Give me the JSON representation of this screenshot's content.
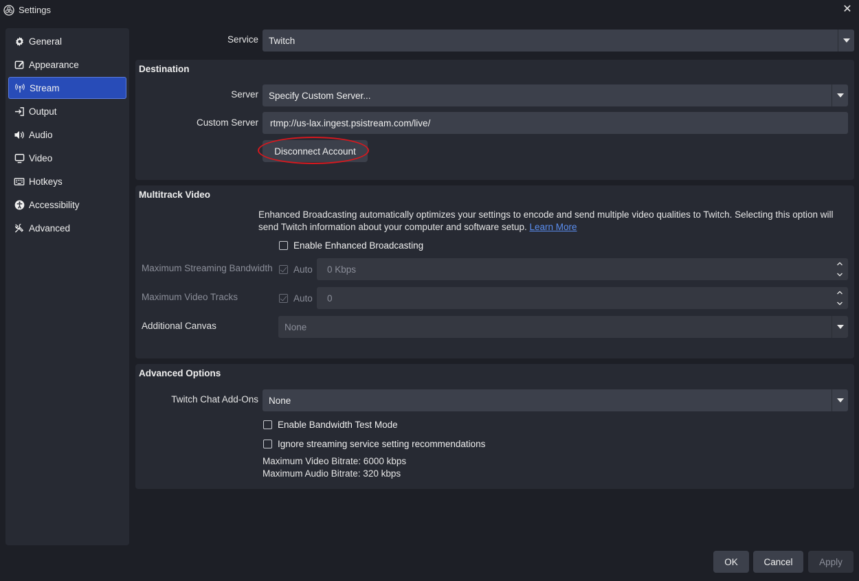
{
  "window": {
    "title": "Settings"
  },
  "sidebar": {
    "items": [
      {
        "label": "General",
        "icon": "gear-icon"
      },
      {
        "label": "Appearance",
        "icon": "appearance-icon"
      },
      {
        "label": "Stream",
        "icon": "stream-icon",
        "active": true
      },
      {
        "label": "Output",
        "icon": "output-icon"
      },
      {
        "label": "Audio",
        "icon": "speaker-icon"
      },
      {
        "label": "Video",
        "icon": "monitor-icon"
      },
      {
        "label": "Hotkeys",
        "icon": "keyboard-icon"
      },
      {
        "label": "Accessibility",
        "icon": "accessibility-icon"
      },
      {
        "label": "Advanced",
        "icon": "tools-icon"
      }
    ]
  },
  "service": {
    "label": "Service",
    "value": "Twitch"
  },
  "destination": {
    "title": "Destination",
    "server_label": "Server",
    "server_value": "Specify Custom Server...",
    "custom_server_label": "Custom Server",
    "custom_server_value": "rtmp://us-lax.ingest.psistream.com/live/",
    "disconnect_label": "Disconnect Account"
  },
  "multitrack": {
    "title": "Multitrack Video",
    "info_text": "Enhanced Broadcasting automatically optimizes your settings to encode and send multiple video qualities to Twitch. Selecting this option will",
    "info_text_2": "send Twitch information about your computer and software setup.",
    "learn_more": "Learn More",
    "enable_label": "Enable Enhanced Broadcasting",
    "bandwidth_label": "Maximum Streaming Bandwidth",
    "bandwidth_auto": "Auto",
    "bandwidth_value": "0 Kbps",
    "tracks_label": "Maximum Video Tracks",
    "tracks_auto": "Auto",
    "tracks_value": "0",
    "canvas_label": "Additional Canvas",
    "canvas_value": "None"
  },
  "advanced_options": {
    "title": "Advanced Options",
    "chat_label": "Twitch Chat Add-Ons",
    "chat_value": "None",
    "bandwidth_test_label": "Enable Bandwidth Test Mode",
    "ignore_label": "Ignore streaming service setting recommendations",
    "max_video": "Maximum Video Bitrate: 6000 kbps",
    "max_audio": "Maximum Audio Bitrate: 320 kbps"
  },
  "footer": {
    "ok": "OK",
    "cancel": "Cancel",
    "apply": "Apply"
  },
  "colors": {
    "accent": "#284cb8",
    "highlight": "#d8181e"
  }
}
